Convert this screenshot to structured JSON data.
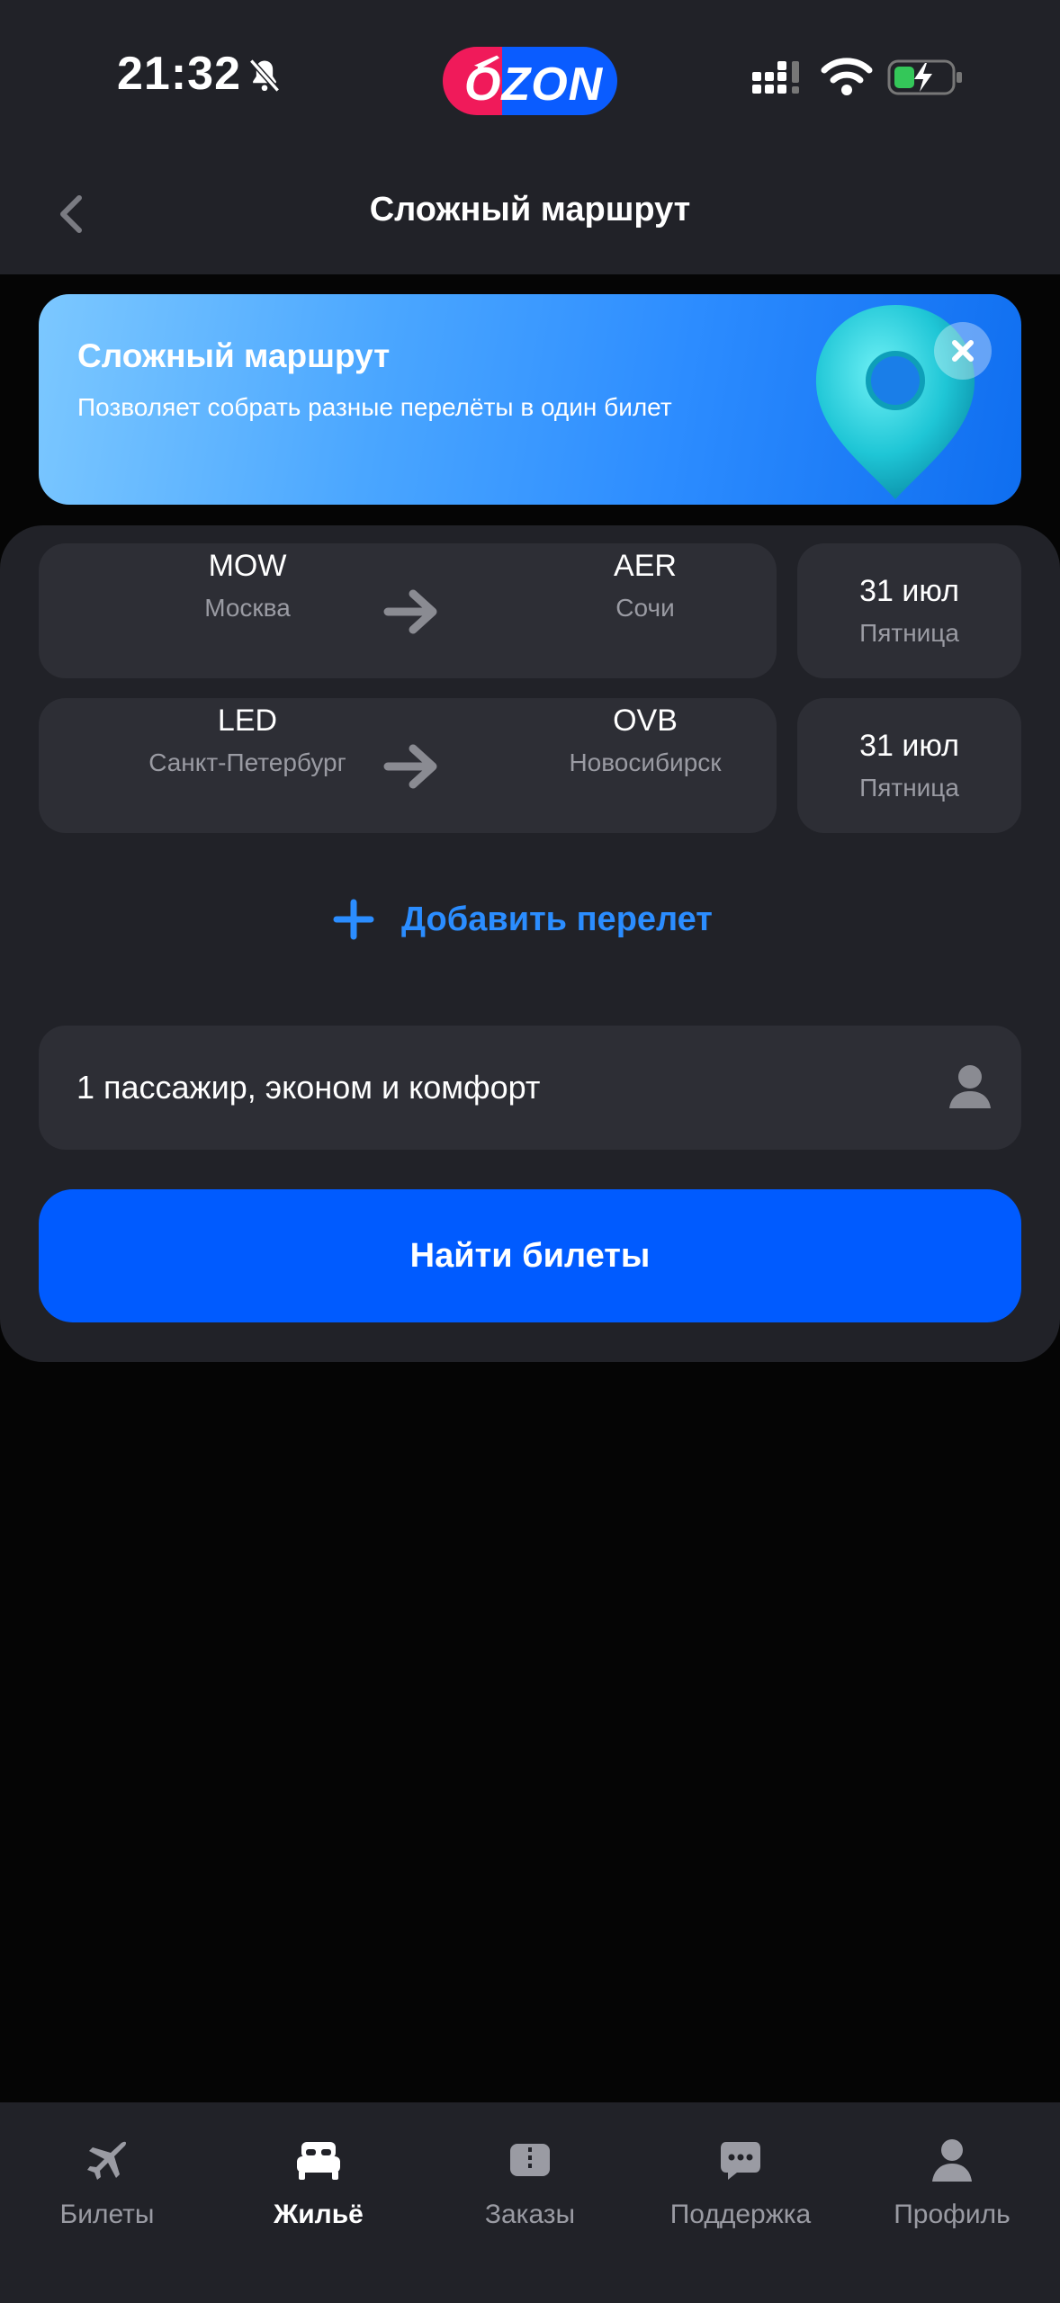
{
  "status_bar": {
    "time": "21:32",
    "icons": [
      "bell-slash-icon",
      "signal-icon",
      "wifi-icon",
      "battery-charging-icon"
    ]
  },
  "logo": {
    "text": "OZON",
    "brand_colors": [
      "#f01a5a",
      "#005bff"
    ]
  },
  "header": {
    "title": "Сложный маршрут",
    "back_icon": "chevron-left-icon"
  },
  "promo": {
    "title": "Сложный маршрут",
    "subtitle": "Позволяет собрать разные перелёты в один билет",
    "close_icon": "close-icon",
    "illustration": "map-pin-icon"
  },
  "routes": [
    {
      "from_code": "MOW",
      "from_city": "Москва",
      "to_code": "AER",
      "to_city": "Сочи",
      "date": "31 июл",
      "weekday": "Пятница"
    },
    {
      "from_code": "LED",
      "from_city": "Санкт-Петербург",
      "to_code": "OVB",
      "to_city": "Новосибирск",
      "date": "31 июл",
      "weekday": "Пятница"
    }
  ],
  "add_flight": {
    "label": "Добавить перелет",
    "icon": "plus-icon"
  },
  "passengers": {
    "label": "1 пассажир, эконом и комфорт",
    "icon": "person-icon"
  },
  "search_button": {
    "label": "Найти билеты"
  },
  "tabs": [
    {
      "label": "Билеты",
      "icon": "plane-icon",
      "active": false
    },
    {
      "label": "Жильё",
      "icon": "bed-icon",
      "active": true
    },
    {
      "label": "Заказы",
      "icon": "ticket-icon",
      "active": false
    },
    {
      "label": "Поддержка",
      "icon": "chat-icon",
      "active": false
    },
    {
      "label": "Профиль",
      "icon": "profile-icon",
      "active": false
    }
  ],
  "colors": {
    "accent": "#005bff",
    "link": "#2b8dff",
    "surface": "#212228",
    "field": "#2d2e35",
    "muted_text": "#9a9ba3"
  }
}
